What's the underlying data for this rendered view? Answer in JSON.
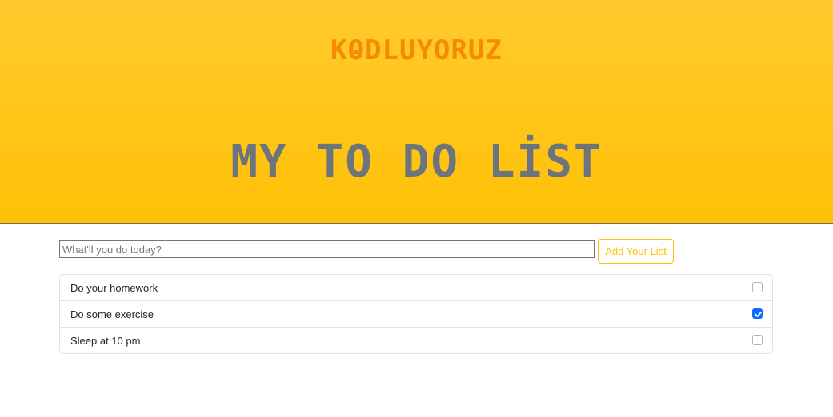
{
  "header": {
    "logo_text_prefix": "K",
    "logo_text_suffix": "DLUYORUZ",
    "title": "MY TO DO LİST",
    "accent_color": "#ffc107",
    "logo_color": "#f58a07"
  },
  "add_form": {
    "input_placeholder": "What'll you do today?",
    "input_value": "",
    "button_label": "Add Your List"
  },
  "tasks": [
    {
      "label": "Do your homework",
      "checked": false
    },
    {
      "label": "Do some exercise",
      "checked": true
    },
    {
      "label": "Sleep at 10 pm",
      "checked": false
    }
  ]
}
